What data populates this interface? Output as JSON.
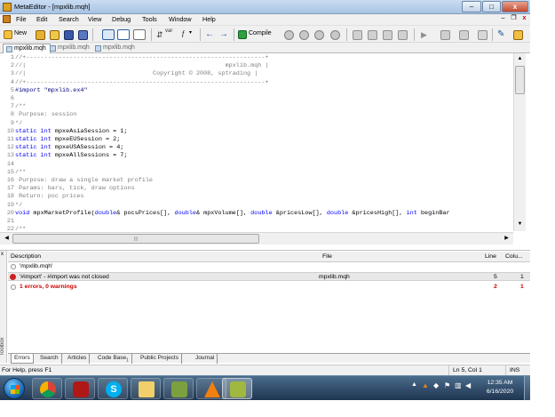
{
  "window": {
    "title": "MetaEditor - [mpxlib.mqh]",
    "buttons": {
      "minimize": "–",
      "maximize": "□",
      "close": "x"
    }
  },
  "menu": {
    "items": [
      "File",
      "Edit",
      "Search",
      "View",
      "Debug",
      "Tools",
      "Window",
      "Help"
    ],
    "mdi_buttons": {
      "minimize": "–",
      "restore": "❐",
      "close": "x"
    }
  },
  "toolbar": {
    "new_label": "New",
    "compile_label": "Compile",
    "var_label": "var",
    "func_label": "f"
  },
  "tabs": [
    "mpxlib.mqh",
    "mpxlib.mqh",
    "mpxlib.mqh"
  ],
  "editor": {
    "lines": [
      {
        "n": "1",
        "t": "//+------------------------------------------------------------------+",
        "c": "cm"
      },
      {
        "n": "2",
        "t": "//|                                                       mpxlib.mqh |",
        "c": "cm"
      },
      {
        "n": "3",
        "t": "//|                                   Copyright © 2008, sptrading |",
        "c": "cm"
      },
      {
        "n": "4",
        "t": "//+------------------------------------------------------------------+",
        "c": "cm"
      },
      {
        "n": "5",
        "t": "#import \"mpxlib.ex4\"",
        "c": "pp"
      },
      {
        "n": "6",
        "t": "",
        "c": ""
      },
      {
        "n": "7",
        "t": "/**",
        "c": "cm"
      },
      {
        "n": "8",
        "t": " Purpose: session",
        "c": "cm"
      },
      {
        "n": "9",
        "t": "*/",
        "c": "cm"
      },
      {
        "n": "10",
        "kw": "static int",
        "rest": " mpxeAsiaSession = 1;"
      },
      {
        "n": "11",
        "kw": "static int",
        "rest": " mpxeEUSession = 2;"
      },
      {
        "n": "12",
        "kw": "static int",
        "rest": " mpxeUSASession = 4;"
      },
      {
        "n": "13",
        "kw": "static int",
        "rest": " mpxeAllSessions = 7;"
      },
      {
        "n": "14",
        "t": "",
        "c": ""
      },
      {
        "n": "15",
        "t": "/**",
        "c": "cm"
      },
      {
        "n": "16",
        "t": " Purpose: draw a single market profile",
        "c": "cm"
      },
      {
        "n": "17",
        "t": " Params: bars, tick, draw options",
        "c": "cm"
      },
      {
        "n": "18",
        "t": " Return: poc prices",
        "c": "cm"
      },
      {
        "n": "19",
        "t": "*/",
        "c": "cm"
      },
      {
        "n": "20",
        "t": "void mpxMarketProfile(double& pocsPrices[], double& mpxVolume[], double &pricesLow[], double &pricesHigh[], int beginBar",
        "c": "code"
      },
      {
        "n": "21",
        "t": "",
        "c": ""
      },
      {
        "n": "22",
        "t": "/**",
        "c": "cm"
      }
    ],
    "hscroll_grip": "|||"
  },
  "toolbox": {
    "side_label": "Toolbox",
    "close": "x",
    "columns": {
      "description": "Description",
      "file": "File",
      "line": "Line",
      "column": "Colu..."
    },
    "rows": [
      {
        "description": "'mpxlib.mqh'",
        "file": "",
        "line": "",
        "column": "",
        "type": "info"
      },
      {
        "description": "'#import' - #import was not closed",
        "file": "mpxlib.mqh",
        "line": "5",
        "column": "1",
        "type": "error"
      },
      {
        "description": "1 errors, 0 warnings",
        "file": "",
        "line": "2",
        "column": "1",
        "type": "summary"
      }
    ],
    "tabs": [
      "Errors",
      "Search",
      "Articles",
      "Code Base",
      "Public Projects",
      "Journal"
    ],
    "codebase_badge": "1"
  },
  "statusbar": {
    "help": "For Help, press F1",
    "position": "Ln 5, Col 1",
    "mode": "INS"
  },
  "taskbar": {
    "apps": [
      "windows-explorer",
      "chrome",
      "winrar",
      "skype",
      "file-explorer",
      "metatrader",
      "vlc",
      "metaeditor"
    ],
    "time": "12:35 AM",
    "date": "6/16/2020"
  }
}
